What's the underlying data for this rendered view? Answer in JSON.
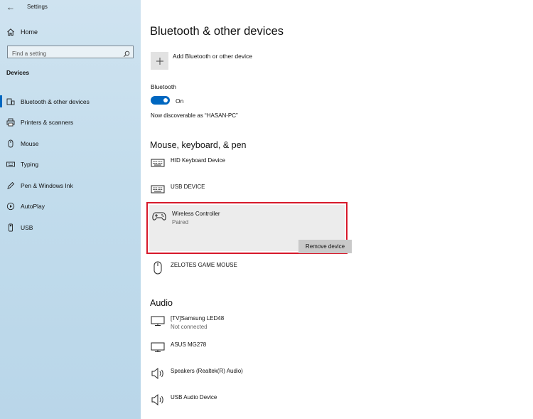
{
  "app": {
    "title": "Settings"
  },
  "sidebar": {
    "home_label": "Home",
    "search_placeholder": "Find a setting",
    "section_label": "Devices",
    "items": [
      {
        "label": "Bluetooth & other devices",
        "icon": "bluetooth-devices-icon",
        "active": true
      },
      {
        "label": "Printers & scanners",
        "icon": "printer-icon",
        "active": false
      },
      {
        "label": "Mouse",
        "icon": "mouse-icon",
        "active": false
      },
      {
        "label": "Typing",
        "icon": "keyboard-icon",
        "active": false
      },
      {
        "label": "Pen & Windows Ink",
        "icon": "pen-icon",
        "active": false
      },
      {
        "label": "AutoPlay",
        "icon": "autoplay-icon",
        "active": false
      },
      {
        "label": "USB",
        "icon": "usb-icon",
        "active": false
      }
    ]
  },
  "main": {
    "title": "Bluetooth & other devices",
    "add_device_label": "Add Bluetooth or other device",
    "bluetooth_label": "Bluetooth",
    "bluetooth_state": "On",
    "discoverable_text": "Now discoverable as “HASAN-PC”",
    "mouse_section": {
      "heading": "Mouse, keyboard, & pen",
      "devices": [
        {
          "name": "HID Keyboard Device",
          "status": "",
          "icon": "keyboard-icon"
        },
        {
          "name": "USB DEVICE",
          "status": "",
          "icon": "keyboard-icon"
        },
        {
          "name": "Wireless Controller",
          "status": "Paired",
          "icon": "gamepad-icon",
          "selected": true,
          "action": "Remove device"
        },
        {
          "name": "ZELOTES GAME MOUSE",
          "status": "",
          "icon": "mouse-icon"
        }
      ]
    },
    "audio_section": {
      "heading": "Audio",
      "devices": [
        {
          "name": "[TV]Samsung LED48",
          "status": "Not connected",
          "icon": "monitor-icon"
        },
        {
          "name": "ASUS MG278",
          "status": "",
          "icon": "monitor-icon"
        },
        {
          "name": "Speakers (Realtek(R) Audio)",
          "status": "",
          "icon": "speaker-icon"
        },
        {
          "name": "USB Audio Device",
          "status": "",
          "icon": "speaker-icon"
        }
      ]
    }
  },
  "colors": {
    "accent": "#0067c0",
    "highlight_border": "#d7192a"
  }
}
